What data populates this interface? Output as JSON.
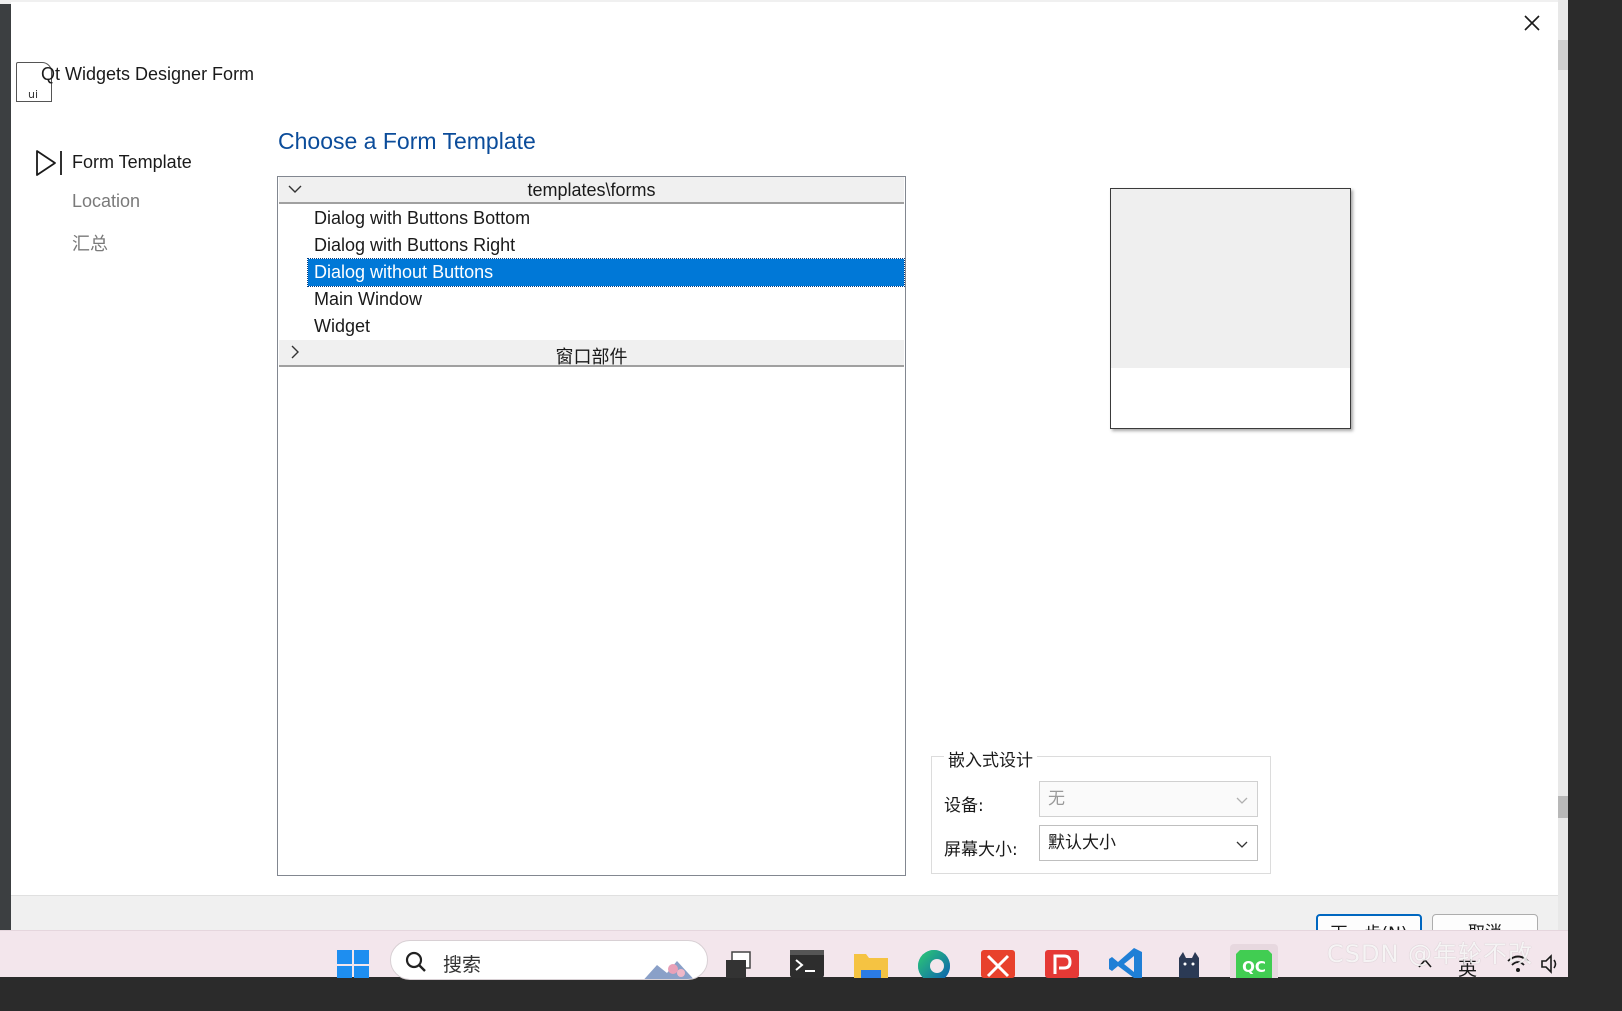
{
  "dialog": {
    "header_title": "Qt Widgets Designer Form",
    "header_icon_text": "ui",
    "steps": [
      {
        "label": "Form Template",
        "active": true
      },
      {
        "label": "Location",
        "active": false
      },
      {
        "label": "汇总",
        "active": false
      }
    ],
    "page_title": "Choose a Form Template",
    "tree": {
      "groups": [
        {
          "label": "templates\\forms",
          "expanded": true,
          "items": [
            {
              "label": "Dialog with Buttons Bottom",
              "selected": false
            },
            {
              "label": "Dialog with Buttons Right",
              "selected": false
            },
            {
              "label": "Dialog without Buttons",
              "selected": true
            },
            {
              "label": "Main Window",
              "selected": false
            },
            {
              "label": "Widget",
              "selected": false
            }
          ]
        },
        {
          "label": "窗口部件",
          "expanded": false,
          "items": []
        }
      ]
    },
    "embedded": {
      "title": "嵌入式设计",
      "device_label": "设备:",
      "device_value": "无",
      "screen_label": "屏幕大小:",
      "screen_value": "默认大小"
    },
    "buttons": {
      "next": "下一步(N)",
      "cancel": "取消"
    }
  },
  "taskbar": {
    "search_placeholder": "搜索",
    "icons": [
      "windows-start-icon",
      "task-view-icon",
      "terminal-icon",
      "file-explorer-icon",
      "edge-icon",
      "xmind-icon",
      "pdf-reader-icon",
      "vscode-icon",
      "cat-app-icon",
      "qt-creator-icon"
    ],
    "tray": {
      "ime": "英"
    }
  },
  "watermark": "CSDN @年轮不改",
  "colors": {
    "accent": "#0078d7",
    "title_blue": "#0b4c9a",
    "taskbar_bg": "#f3e6ec"
  }
}
